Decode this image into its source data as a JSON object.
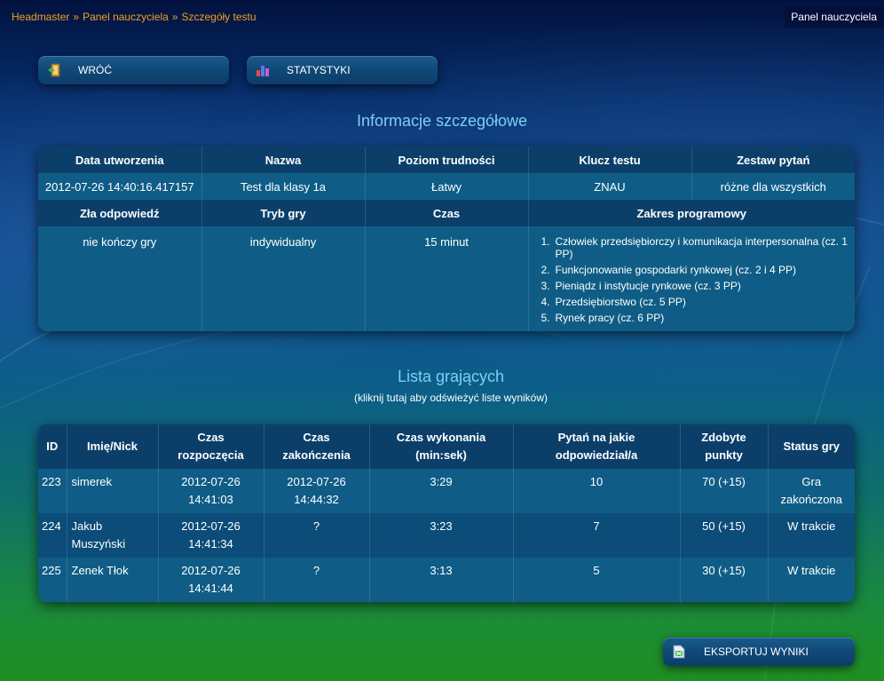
{
  "breadcrumb": [
    "Headmaster",
    "Panel nauczyciela",
    "Szczegóły testu"
  ],
  "panel_label": "Panel nauczyciela",
  "buttons": {
    "back": "WRÓĆ",
    "stats": "STATYSTYKI",
    "export": "EKSPORTUJ WYNIKI"
  },
  "info": {
    "title": "Informacje szczegółowe",
    "headers1": [
      "Data utworzenia",
      "Nazwa",
      "Poziom trudności",
      "Klucz testu",
      "Zestaw pytań"
    ],
    "values1": [
      "2012-07-26 14:40:16.417157",
      "Test dla klasy 1a",
      "Łatwy",
      "ZNAU",
      "różne dla wszystkich"
    ],
    "headers2": [
      "Zła odpowiedź",
      "Tryb gry",
      "Czas",
      "Zakres programowy"
    ],
    "values2": [
      "nie kończy gry",
      "indywidualny",
      "15 minut"
    ],
    "scope": [
      "Człowiek przedsiębiorczy i komunikacja interpersonalna (cz. 1 PP)",
      "Funkcjonowanie gospodarki rynkowej (cz. 2 i 4 PP)",
      "Pieniądz i instytucje rynkowe (cz. 3 PP)",
      "Przedsiębiorstwo (cz. 5 PP)",
      "Rynek pracy (cz. 6 PP)"
    ]
  },
  "players": {
    "title": "Lista grających",
    "refresh_hint": "(kliknij tutaj aby odświeżyć liste wyników)",
    "headers": [
      [
        "ID"
      ],
      [
        "Imię/Nick"
      ],
      [
        "Czas",
        "rozpoczęcia"
      ],
      [
        "Czas",
        "zakończenia"
      ],
      [
        "Czas wykonania",
        "(min:sek)"
      ],
      [
        "Pytań na jakie",
        "odpowiedział/a"
      ],
      [
        "Zdobyte",
        "punkty"
      ],
      [
        "Status gry"
      ]
    ],
    "rows": [
      {
        "id": "223",
        "nick": [
          "simerek"
        ],
        "start": [
          "2012-07-26",
          "14:41:03"
        ],
        "end": [
          "2012-07-26",
          "14:44:32"
        ],
        "duration": "3:29",
        "answered": "10",
        "points": "70 (+15)",
        "status": [
          "Gra",
          "zakończona"
        ]
      },
      {
        "id": "224",
        "nick": [
          "Jakub",
          "Muszyński"
        ],
        "start": [
          "2012-07-26",
          "14:41:34"
        ],
        "end": [
          "?"
        ],
        "duration": "3:23",
        "answered": "7",
        "points": "50 (+15)",
        "status": [
          "W trakcie"
        ]
      },
      {
        "id": "225",
        "nick": [
          "Zenek Tłok"
        ],
        "start": [
          "2012-07-26",
          "14:41:44"
        ],
        "end": [
          "?"
        ],
        "duration": "3:13",
        "answered": "5",
        "points": "30 (+15)",
        "status": [
          "W trakcie"
        ]
      }
    ]
  },
  "icons": {
    "back": "exit-door-icon",
    "stats": "bar-chart-icon",
    "export": "spreadsheet-export-icon"
  },
  "colors": {
    "breadcrumb": "#f0a020",
    "section_title": "#7fd0f0",
    "table_header": "#0b3f6a",
    "row_light": "#0f5d86",
    "row_dark": "#0b4c78"
  }
}
